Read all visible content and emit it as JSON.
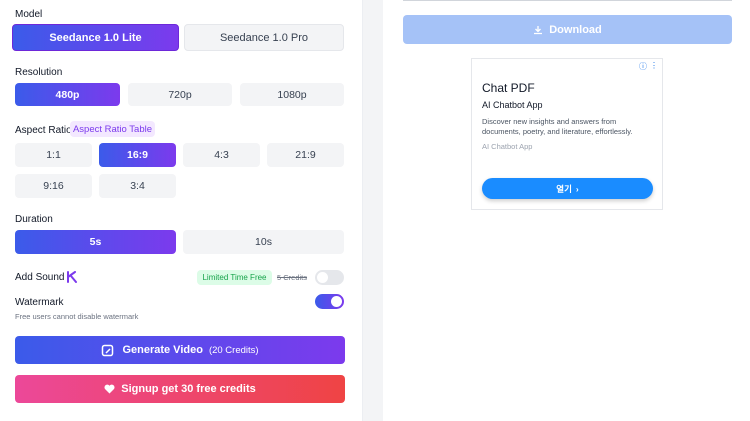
{
  "form": {
    "model_label": "Model",
    "models": [
      "Seedance 1.0 Lite",
      "Seedance 1.0 Pro"
    ],
    "resolution_label": "Resolution",
    "resolutions": [
      "480p",
      "720p",
      "1080p"
    ],
    "aspect_label": "Aspect Ratio",
    "aspect_table": "Aspect Ratio Table",
    "aspects": [
      "1:1",
      "16:9",
      "4:3",
      "21:9",
      "9:16",
      "3:4"
    ],
    "duration_label": "Duration",
    "durations": [
      "5s",
      "10s"
    ],
    "sound_label": "Add Sound",
    "sound_badge": "Limited Time Free",
    "sound_credits": "5 Credits",
    "watermark_label": "Watermark",
    "watermark_note": "Free users cannot disable watermark",
    "generate_label": "Generate Video",
    "generate_credits": "(20 Credits)",
    "signup_label": "Signup get 30 free credits"
  },
  "preview": {
    "download_label": "Download"
  },
  "ad": {
    "title": "Chat PDF",
    "subtitle": "AI Chatbot App",
    "description": "Discover new insights and answers from documents, poetry, and literature, effortlessly.",
    "source": "AI Chatbot App",
    "cta": "열기"
  },
  "colors": {
    "accent_start": "#3b5bea",
    "accent_end": "#7c3aed",
    "signup_start": "#ec4899",
    "signup_end": "#ef4444",
    "download_bg": "#a5c2f7",
    "ad_button": "#1a8cff"
  },
  "icons": {
    "kling": "kling-logo-icon",
    "generate": "video-edit-icon",
    "signup": "heart-icon",
    "download": "download-icon",
    "ad_info": "info-icon",
    "ad_menu": "more-vert-icon",
    "ad_cta": "chevron-right-icon"
  }
}
